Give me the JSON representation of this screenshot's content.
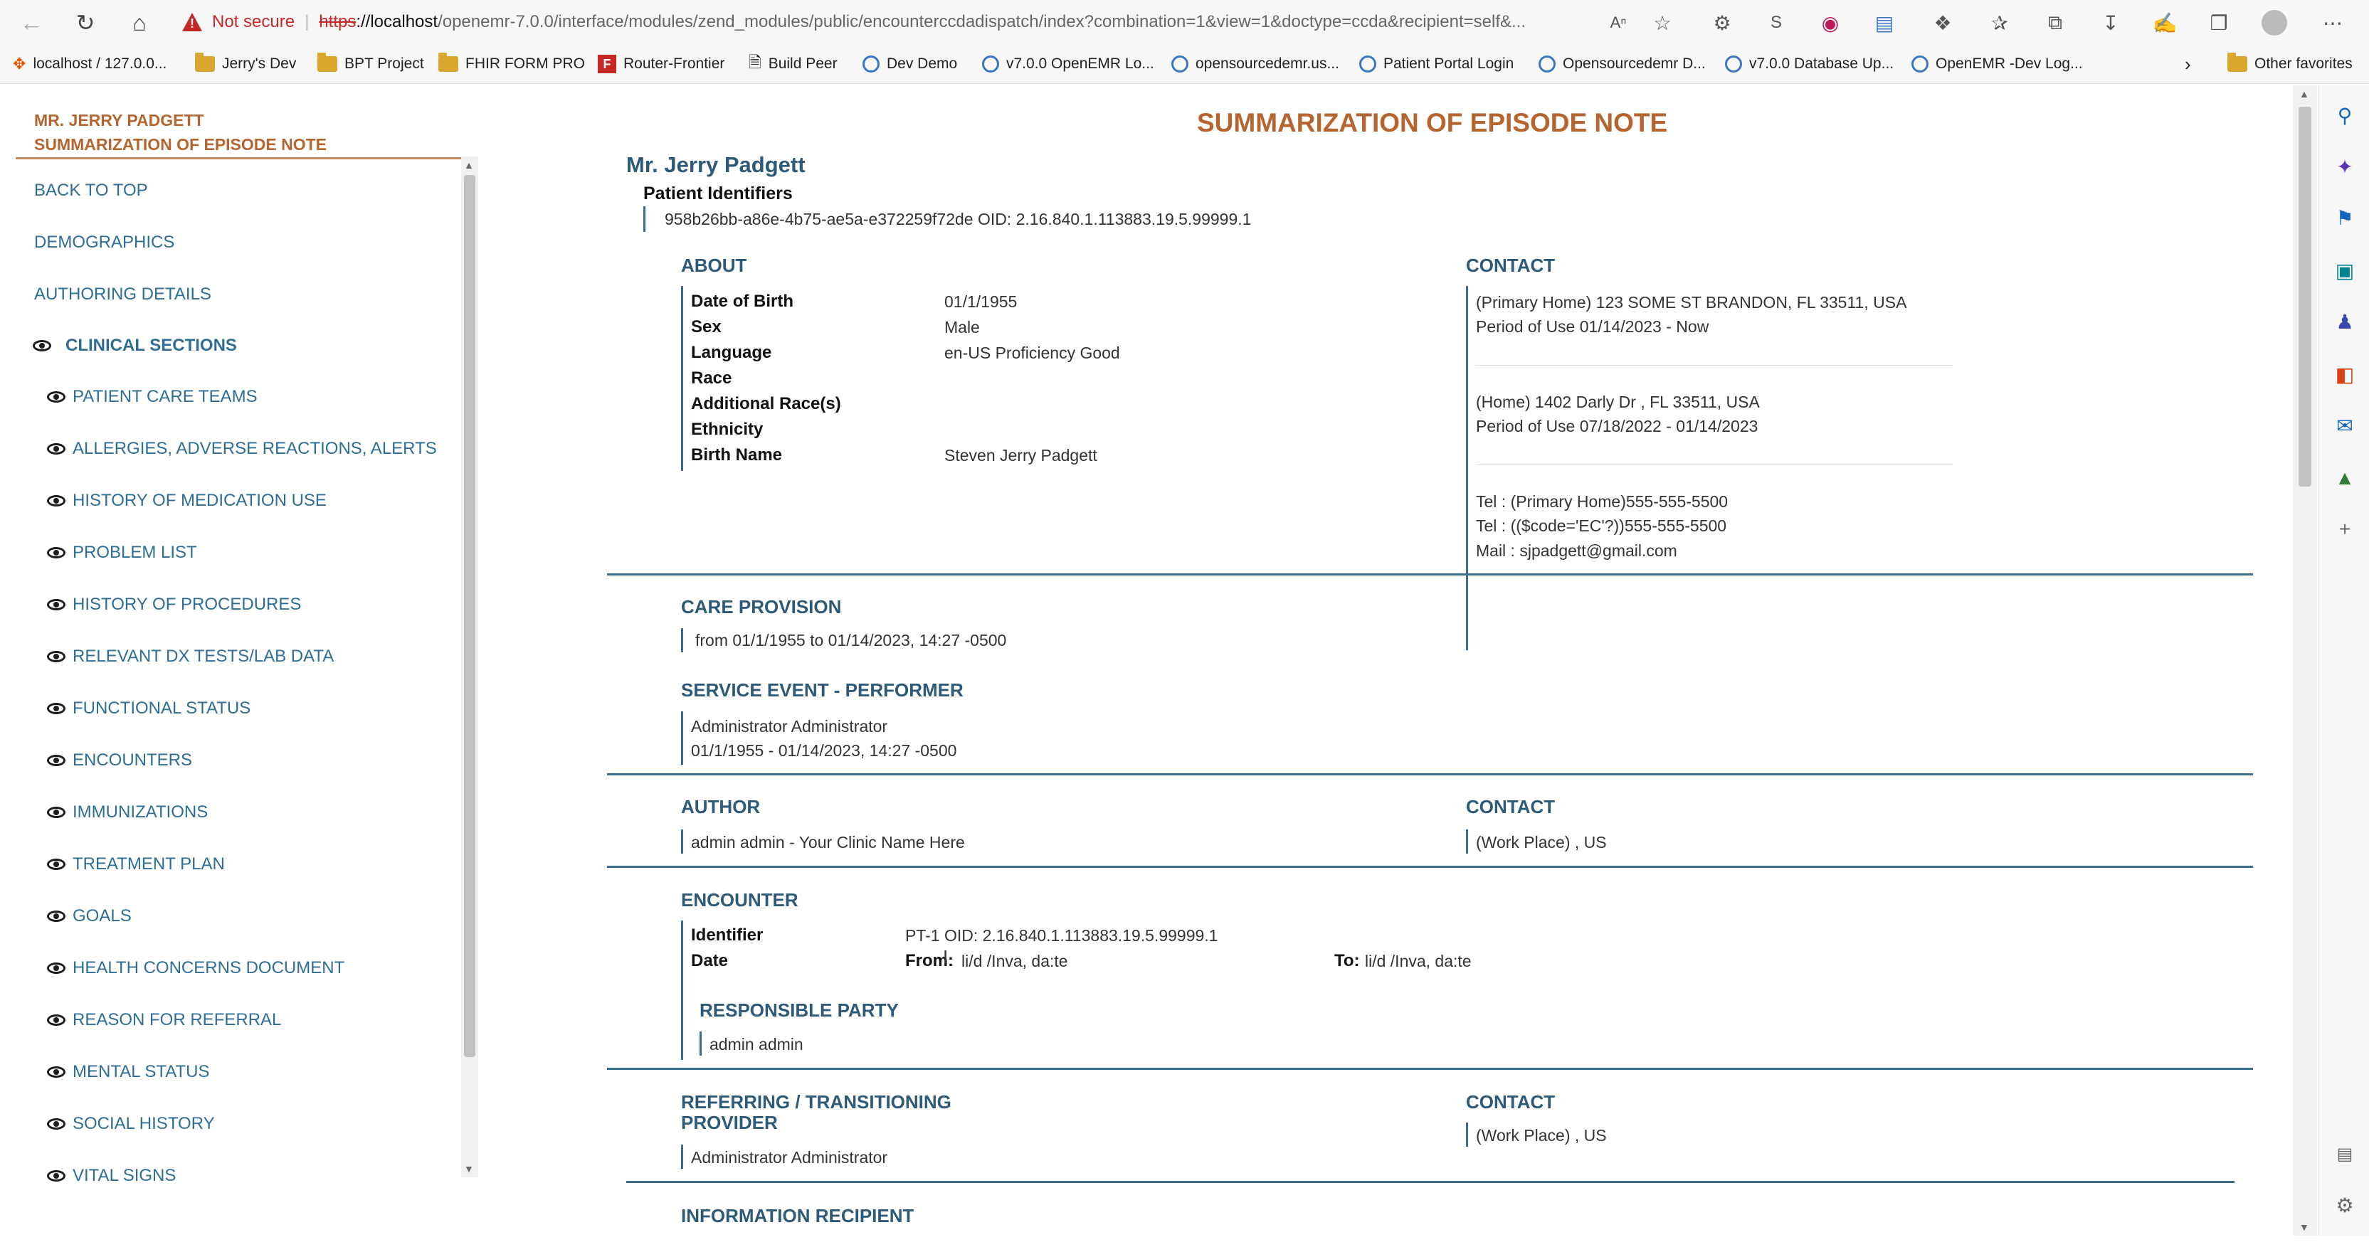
{
  "browser": {
    "not_secure": "Not secure",
    "url_scheme": "https",
    "url_host": "://localhost",
    "url_path": "/openemr-7.0.0/interface/modules/zend_modules/public/encounterccdadispatch/index?combination=1&view=1&doctype=ccda&recipient=self&...",
    "bookmarks": [
      "localhost / 127.0.0...",
      "Jerry's Dev",
      "BPT Project",
      "FHIR FORM PRO",
      "Router-Frontier",
      "Build Peer",
      "Dev Demo",
      "v7.0.0 OpenEMR Lo...",
      "opensourcedemr.us...",
      "Patient Portal Login",
      "Opensourcedemr D...",
      "v7.0.0 Database Up...",
      "OpenEMR -Dev Log..."
    ],
    "other_favorites": "Other favorites"
  },
  "sidebar": {
    "title_line1": "MR. JERRY PADGETT",
    "title_line2": "SUMMARIZATION OF EPISODE NOTE",
    "top_links": [
      "BACK TO TOP",
      "DEMOGRAPHICS",
      "AUTHORING DETAILS"
    ],
    "clinical_sections": "CLINICAL SECTIONS",
    "sections": [
      "PATIENT CARE TEAMS",
      "ALLERGIES, ADVERSE REACTIONS, ALERTS",
      "HISTORY OF MEDICATION USE",
      "PROBLEM LIST",
      "HISTORY OF PROCEDURES",
      "RELEVANT DX TESTS/LAB DATA",
      "FUNCTIONAL STATUS",
      "ENCOUNTERS",
      "IMMUNIZATIONS",
      "TREATMENT PLAN",
      "GOALS",
      "HEALTH CONCERNS DOCUMENT",
      "REASON FOR REFERRAL",
      "MENTAL STATUS",
      "SOCIAL HISTORY",
      "VITAL SIGNS"
    ]
  },
  "doc": {
    "title": "SUMMARIZATION OF EPISODE NOTE",
    "patient_name": "Mr. Jerry Padgett",
    "identifiers_label": "Patient Identifiers",
    "identifier": "958b26bb-a86e-4b75-ae5a-e372259f72de OID: 2.16.840.1.113883.19.5.99999.1",
    "about": {
      "heading": "ABOUT",
      "rows": [
        {
          "label": "Date of Birth",
          "value": "01/1/1955"
        },
        {
          "label": "Sex",
          "value": "Male"
        },
        {
          "label": "Language",
          "value": "en-US Proficiency Good"
        },
        {
          "label": "Race",
          "value": ""
        },
        {
          "label": "Additional Race(s)",
          "value": ""
        },
        {
          "label": "Ethnicity",
          "value": ""
        },
        {
          "label": "Birth Name",
          "value": "Steven Jerry Padgett"
        }
      ]
    },
    "contact": {
      "heading": "CONTACT",
      "addr1": "(Primary Home) 123 SOME ST BRANDON, FL 33511, USA",
      "period1": "Period of Use 01/14/2023 - Now",
      "addr2": "(Home) 1402 Darly Dr , FL 33511, USA",
      "period2": "Period of Use 07/18/2022 - 01/14/2023",
      "tel1": "Tel : (Primary Home)555-555-5500",
      "tel2": "Tel : (($code='EC'?))555-555-5500",
      "mail": "Mail : sjpadgett@gmail.com"
    },
    "care_provision": {
      "heading": "CARE PROVISION",
      "text": "from 01/1/1955 to 01/14/2023, 14:27 -0500"
    },
    "service_event": {
      "heading": "SERVICE EVENT - PERFORMER",
      "name": "Administrator Administrator",
      "dates": "01/1/1955 - 01/14/2023, 14:27 -0500"
    },
    "author": {
      "heading": "AUTHOR",
      "text": "admin admin - Your Clinic Name Here",
      "contact_heading": "CONTACT",
      "contact_text": "(Work Place) , US"
    },
    "encounter": {
      "heading": "ENCOUNTER",
      "identifier_label": "Identifier",
      "identifier_value": "PT-1 OID: 2.16.840.1.113883.19.5.99999.1",
      "date_label": "Date",
      "from_label": "From:",
      "from_value": "li/d /Inva, da:te",
      "to_label": "To:",
      "to_value": "li/d /Inva, da:te",
      "responsible_heading": "RESPONSIBLE PARTY",
      "responsible_value": "admin admin"
    },
    "referring": {
      "heading_line1": "REFERRING / TRANSITIONING",
      "heading_line2": "PROVIDER",
      "text": "Administrator Administrator",
      "contact_heading": "CONTACT",
      "contact_text": "(Work Place) , US"
    },
    "info_recipient": {
      "heading": "INFORMATION RECIPIENT"
    }
  }
}
